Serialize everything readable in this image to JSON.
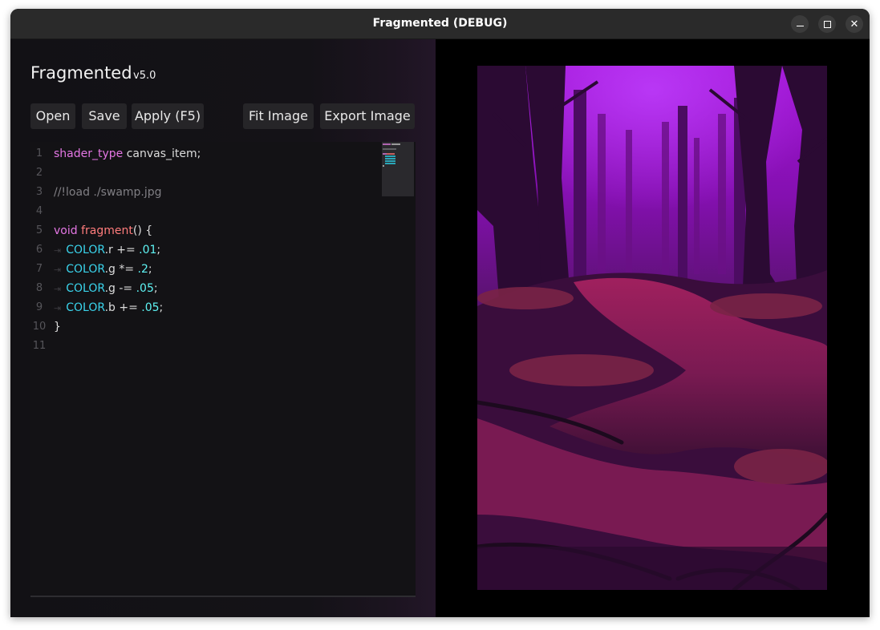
{
  "window": {
    "title": "Fragmented (DEBUG)",
    "controls": {
      "minimize": "minimize",
      "maximize": "maximize",
      "close": "✕"
    }
  },
  "app": {
    "name": "Fragmented",
    "version": "v5.0"
  },
  "toolbar": {
    "open": "Open",
    "save": "Save",
    "apply": "Apply (F5)",
    "fit_image": "Fit Image",
    "export_image": "Export Image"
  },
  "editor": {
    "line_numbers": [
      "1",
      "2",
      "3",
      "4",
      "5",
      "6",
      "7",
      "8",
      "9",
      "10",
      "11"
    ],
    "lines": {
      "l1": {
        "kw": "shader_type",
        "rest": " canvas_item;"
      },
      "l3": {
        "comment": "//!load ./swamp.jpg"
      },
      "l5": {
        "kw": "void",
        "fn": "fragment",
        "rest": "() {"
      },
      "l6": {
        "id": "COLOR",
        "member": ".r += ",
        "num": ".01",
        "end": ";"
      },
      "l7": {
        "id": "COLOR",
        "member": ".g *= ",
        "num": ".2",
        "end": ";"
      },
      "l8": {
        "id": "COLOR",
        "member": ".g -= ",
        "num": ".05",
        "end": ";"
      },
      "l9": {
        "id": "COLOR",
        "member": ".b += ",
        "num": ".05",
        "end": ";"
      },
      "l10": {
        "rest": "}"
      }
    },
    "tab_glyph": "⇥"
  },
  "colors": {
    "keyword": "#e476e4",
    "function": "#ff7c7c",
    "comment": "#807f84",
    "identifier": "#3ad4ec",
    "number": "#5ef4f4",
    "image_sky": "#a214d6",
    "image_water": "#b0246a"
  },
  "preview": {
    "image": "purple swamp forest"
  }
}
